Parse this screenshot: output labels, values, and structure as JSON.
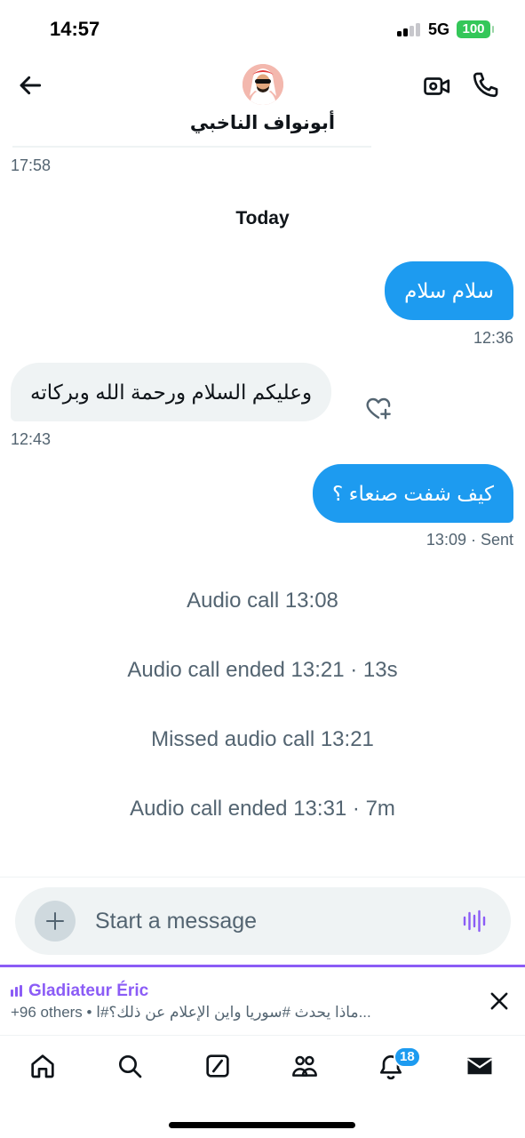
{
  "status_bar": {
    "time": "14:57",
    "network": "5G",
    "battery": "100"
  },
  "header": {
    "contact_name": "أبونواف الناخبي",
    "icons": [
      "back-arrow-icon",
      "video-call-icon",
      "phone-icon"
    ]
  },
  "conversation": {
    "earlier_timestamp": "17:58",
    "date_separator": "Today",
    "messages": [
      {
        "direction": "outgoing",
        "text": "سلام سلام",
        "time": "12:36"
      },
      {
        "direction": "incoming",
        "text": "وعليكم السلام ورحمة الله وبركاته",
        "time": "12:43"
      },
      {
        "direction": "outgoing",
        "text": "كيف شفت صنعاء ؟",
        "time": "13:09 · Sent"
      }
    ],
    "call_events": [
      "Audio call 13:08",
      "Audio call ended 13:21 · 13s",
      "Missed audio call 13:21",
      "Audio call ended 13:31 · 7m"
    ]
  },
  "composer": {
    "placeholder": "Start a message"
  },
  "space_banner": {
    "host": "Gladiateur Éric",
    "subtitle": "+96 others • ماذا يحدث #سوريا واين الإعلام عن ذلك؟#ا...",
    "accent_color": "#8b5cf6"
  },
  "tab_bar": {
    "tabs": [
      "home-icon",
      "search-icon",
      "grok-icon",
      "communities-icon",
      "notifications-icon",
      "messages-icon"
    ],
    "notifications_badge": "18"
  },
  "colors": {
    "accent_blue": "#1d9bf0",
    "incoming_bubble": "#eff3f4",
    "secondary_text": "#536471"
  }
}
